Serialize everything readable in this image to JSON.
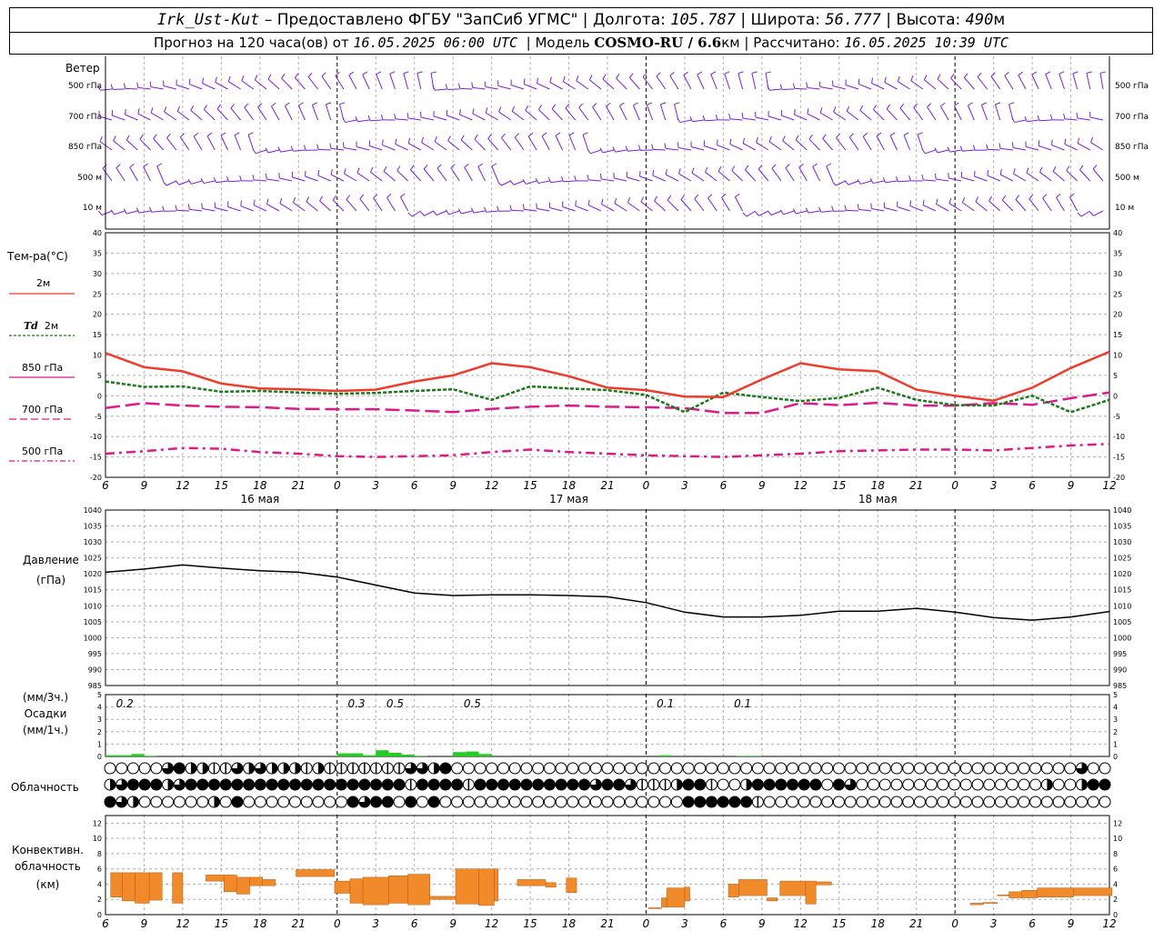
{
  "header": {
    "station": "Irk_Ust-Kut",
    "provided": "– Предоставлено ФГБУ \"ЗапСиб УГМС\"",
    "lon_label": "Долгота:",
    "lon": "105.787",
    "lat_label": "Широта:",
    "lat": "56.777",
    "alt_label": "Высота:",
    "alt": "490",
    "alt_unit": "м",
    "forecast_label": "Прогноз на 120 часа(ов) от",
    "forecast_start": "16.05.2025 06:00 UTC",
    "model_label": "Модель",
    "model": "COSMO-RU / 6.6",
    "model_unit": "км",
    "calc_label": "Рассчитано:",
    "calc_time": "16.05.2025 10:39 UTC"
  },
  "labels": {
    "wind": "Ветер",
    "wind_levels": [
      "500 гПа",
      "700 гПа",
      "850 гПа",
      "500 м",
      "10  м"
    ],
    "temp_title": "Тем-ра(°C)",
    "temp_2m": "2м",
    "td_prefix": "Td",
    "td_suffix": "2м",
    "t850": "850 гПа",
    "t700": "700 гПа",
    "t500": "500 гПа",
    "pressure_title": "Давление",
    "pressure_unit": "(гПа)",
    "precip_3h": "(мм/3ч.)",
    "precip_title": "Осадки",
    "precip_1h": "(мм/1ч.)",
    "cloud": "Облачность",
    "conv_1": "Конвективн.",
    "conv_2": "облачность",
    "conv_3": "(км)"
  },
  "colors": {
    "t2m": "#ef3b2c",
    "td2m": "#1a7a1a",
    "t_levels": "#e0198a",
    "wind": "#7b1fd6",
    "pressure": "#000000",
    "precip": "#22cc22",
    "convective": "#f08a2a"
  },
  "chart_data": [
    {
      "type": "line",
      "name": "temperature",
      "x_ticks": [
        "6",
        "9",
        "12",
        "15",
        "18",
        "21",
        "0",
        "3",
        "6",
        "9",
        "12",
        "15",
        "18",
        "21",
        "0",
        "3",
        "6",
        "9",
        "12",
        "15",
        "18",
        "21",
        "0",
        "3",
        "6",
        "9",
        "12"
      ],
      "day_labels": [
        {
          "text": "16 мая",
          "hour": 12
        },
        {
          "text": "17 мая",
          "hour": 36
        },
        {
          "text": "18 мая",
          "hour": 60
        }
      ],
      "ylim": [
        -20,
        40
      ],
      "y_ticks": [
        "40",
        "35",
        "30",
        "25",
        "20",
        "15",
        "10",
        "5",
        "0",
        "-5",
        "-10",
        "-15",
        "-20"
      ],
      "series": [
        {
          "name": "2м",
          "x": [
            0,
            3,
            6,
            9,
            12,
            15,
            18,
            21,
            24,
            27,
            30,
            33,
            36,
            39,
            42,
            45,
            48,
            51,
            54,
            57,
            60,
            63,
            66,
            69,
            72,
            75,
            78
          ],
          "values": [
            10.5,
            7,
            6,
            3,
            1.8,
            1.6,
            1.2,
            1.5,
            3.5,
            5,
            8,
            7,
            4.8,
            2,
            1.4,
            -0.2,
            -0.3,
            4,
            8,
            6.5,
            6,
            1.5,
            0,
            -1.2,
            2,
            6.8,
            10.8
          ]
        },
        {
          "name": "Td 2м",
          "x": [
            0,
            3,
            6,
            9,
            12,
            15,
            18,
            21,
            24,
            27,
            30,
            33,
            36,
            39,
            42,
            45,
            48,
            51,
            54,
            57,
            60,
            63,
            66,
            69,
            72,
            75,
            78
          ],
          "values": [
            3.5,
            2.2,
            2.3,
            1,
            1.2,
            0.8,
            0.5,
            0.7,
            1.2,
            1.6,
            -1,
            2.3,
            1.8,
            1.4,
            0.2,
            -4,
            0.8,
            -0.3,
            -1.3,
            -0.5,
            2,
            -1,
            -2.3,
            -2.4,
            0,
            -4,
            -1
          ]
        },
        {
          "name": "850 гПа",
          "x": [
            0,
            3,
            6,
            9,
            12,
            15,
            18,
            21,
            24,
            27,
            30,
            33,
            36,
            39,
            42,
            45,
            48,
            51,
            54,
            57,
            60,
            63,
            66,
            69,
            72,
            75,
            78
          ],
          "values": [
            -3,
            -1.8,
            -2.4,
            -2.7,
            -2.8,
            -3.2,
            -3.3,
            -3.3,
            -3.6,
            -4,
            -3.2,
            -2.7,
            -2.4,
            -2.7,
            -2.8,
            -3,
            -4.2,
            -4.2,
            -1.8,
            -2.3,
            -1.7,
            -2.4,
            -2.4,
            -1.8,
            -2.2,
            -0.6,
            0.8
          ]
        },
        {
          "name": "700 гПа",
          "x": [],
          "values": []
        },
        {
          "name": "500 гПа",
          "x": [
            0,
            3,
            6,
            9,
            12,
            15,
            18,
            21,
            24,
            27,
            30,
            33,
            36,
            39,
            42,
            45,
            48,
            51,
            54,
            57,
            60,
            63,
            66,
            69,
            72,
            75,
            78
          ],
          "values": [
            -14.2,
            -13.6,
            -12.8,
            -13,
            -13.8,
            -14.2,
            -14.8,
            -15,
            -14.8,
            -14.6,
            -13.8,
            -13.2,
            -13.8,
            -14.2,
            -14.6,
            -14.8,
            -15,
            -14.6,
            -14.2,
            -13.6,
            -13.4,
            -13.2,
            -13.2,
            -13.4,
            -12.8,
            -12.2,
            -11.8
          ]
        }
      ]
    },
    {
      "type": "line",
      "name": "pressure",
      "ylim": [
        985,
        1040
      ],
      "y_ticks": [
        "1040",
        "1035",
        "1030",
        "1025",
        "1020",
        "1015",
        "1010",
        "1005",
        "1000",
        "995",
        "990",
        "985"
      ],
      "x_ticks": [
        "6",
        "9",
        "12",
        "15",
        "18",
        "21",
        "0",
        "3",
        "6",
        "9",
        "12",
        "15",
        "18",
        "21",
        "0",
        "3",
        "6",
        "9",
        "12",
        "15",
        "18",
        "21",
        "0",
        "3",
        "6",
        "9",
        "12"
      ],
      "series": [
        {
          "name": "Давление",
          "x": [
            0,
            3,
            6,
            9,
            12,
            15,
            18,
            21,
            24,
            27,
            30,
            33,
            36,
            39,
            42,
            45,
            48,
            51,
            54,
            57,
            60,
            63,
            66,
            69,
            72,
            75,
            78
          ],
          "values": [
            1020.5,
            1021.5,
            1022.8,
            1021.8,
            1021,
            1020.5,
            1019,
            1016.5,
            1014,
            1013.2,
            1013.4,
            1013.4,
            1013.2,
            1012.8,
            1011,
            1008,
            1006.5,
            1006.5,
            1007,
            1008.3,
            1008.3,
            1009.2,
            1008,
            1006.3,
            1005.5,
            1006.5,
            1008.2
          ]
        }
      ]
    },
    {
      "type": "bar",
      "name": "precipitation",
      "ylim": [
        0,
        5
      ],
      "y_ticks": [
        "5",
        "4",
        "3",
        "2",
        "1",
        "0"
      ],
      "totals_3h": [
        {
          "hour": 1.5,
          "text": "0.2"
        },
        {
          "hour": 19.5,
          "text": "0.3"
        },
        {
          "hour": 22.5,
          "text": "0.5"
        },
        {
          "hour": 28.5,
          "text": "0.5"
        },
        {
          "hour": 43.5,
          "text": "0.1"
        },
        {
          "hour": 49.5,
          "text": "0.1"
        }
      ],
      "x": [
        0,
        1,
        2,
        3,
        18,
        19,
        20,
        21,
        22,
        23,
        24,
        27,
        28,
        29,
        43,
        49,
        50
      ],
      "values": [
        0.1,
        0.1,
        0.2,
        0.05,
        0.25,
        0.25,
        0.1,
        0.5,
        0.3,
        0.15,
        0.05,
        0.35,
        0.4,
        0.2,
        0.1,
        0.05,
        0.05
      ]
    },
    {
      "type": "table",
      "name": "cloud-cover",
      "legend": "0=clear 1=quarter 2=half 3=three-quarter 4=overcast",
      "rows": [
        [
          0,
          0,
          0,
          0,
          0,
          3,
          4,
          2,
          2,
          1,
          1,
          3,
          2,
          3,
          2,
          2,
          2,
          1,
          2,
          1,
          1,
          1,
          1,
          1,
          1,
          1,
          3,
          3,
          2,
          4,
          0,
          0,
          0,
          0,
          0,
          0,
          0,
          0,
          0,
          0,
          0,
          0,
          0,
          0,
          0,
          0,
          0,
          0,
          0,
          0,
          0,
          0,
          0,
          0,
          0,
          0,
          0,
          0,
          0,
          0,
          0,
          0,
          0,
          0,
          0,
          0,
          0,
          0,
          0,
          0,
          0,
          0,
          0,
          0,
          0,
          0,
          0,
          0,
          0,
          0,
          0,
          0,
          0,
          0,
          3,
          0,
          0
        ],
        [
          2,
          3,
          4,
          4,
          4,
          2,
          3,
          4,
          4,
          4,
          4,
          4,
          4,
          4,
          4,
          4,
          4,
          4,
          4,
          4,
          4,
          4,
          4,
          4,
          4,
          4,
          1,
          4,
          4,
          4,
          4,
          1,
          4,
          4,
          4,
          4,
          4,
          4,
          4,
          4,
          4,
          4,
          3,
          4,
          4,
          3,
          1,
          1,
          1,
          2,
          4,
          4,
          1,
          0,
          0,
          2,
          4,
          4,
          4,
          4,
          4,
          4,
          0,
          4,
          3,
          0,
          0,
          0,
          0,
          0,
          0,
          0,
          0,
          0,
          0,
          0,
          0,
          0,
          0,
          0,
          0,
          2,
          0,
          0,
          2,
          4,
          4
        ],
        [
          4,
          3,
          2,
          0,
          0,
          0,
          0,
          0,
          0,
          2,
          0,
          4,
          0,
          0,
          0,
          0,
          0,
          0,
          0,
          0,
          0,
          4,
          3,
          4,
          4,
          0,
          4,
          0,
          4,
          0,
          0,
          0,
          0,
          0,
          0,
          0,
          0,
          0,
          0,
          0,
          0,
          0,
          0,
          0,
          0,
          0,
          0,
          0,
          0,
          0,
          4,
          4,
          4,
          4,
          4,
          4,
          1,
          0,
          0,
          0,
          0,
          0,
          0,
          0,
          0,
          0,
          0,
          0,
          0,
          0,
          0,
          0,
          0,
          0,
          0,
          0,
          0,
          0,
          0,
          0,
          0,
          0,
          0,
          0,
          0,
          0,
          0
        ]
      ]
    },
    {
      "type": "bar",
      "name": "convective-cloud",
      "ylim": [
        0,
        13
      ],
      "y_ticks": [
        "12",
        "10",
        "8",
        "6",
        "4",
        "2",
        "0"
      ],
      "x_ticks": [
        "6",
        "9",
        "12",
        "15",
        "18",
        "21",
        "0",
        "3",
        "6",
        "9",
        "12",
        "15",
        "18",
        "21",
        "0",
        "3",
        "6",
        "9",
        "12",
        "15",
        "18",
        "21",
        "0",
        "3",
        "6",
        "9",
        "12"
      ],
      "segments": [
        [
          0.4,
          1.3,
          2.3,
          5.5
        ],
        [
          1.3,
          2.3,
          1.8,
          5.5
        ],
        [
          2.3,
          3.4,
          1.5,
          5.5
        ],
        [
          3.4,
          4.4,
          1.9,
          5.5
        ],
        [
          5.2,
          6.0,
          1.5,
          5.5
        ],
        [
          7.8,
          9.2,
          4.4,
          5.2
        ],
        [
          9.2,
          10.2,
          3.0,
          5.2
        ],
        [
          10.2,
          11.2,
          2.7,
          4.9
        ],
        [
          11.2,
          12.2,
          3.8,
          4.9
        ],
        [
          12.2,
          13.2,
          3.8,
          4.6
        ],
        [
          14.8,
          17.8,
          5.0,
          5.9
        ],
        [
          17.8,
          19.0,
          2.8,
          4.4
        ],
        [
          19.0,
          20.0,
          1.5,
          4.7
        ],
        [
          20.0,
          22.0,
          1.3,
          4.9
        ],
        [
          22.0,
          23.5,
          1.5,
          5.1
        ],
        [
          23.5,
          25.2,
          1.3,
          5.3
        ],
        [
          25.2,
          27.2,
          2.0,
          2.4
        ],
        [
          27.2,
          29.0,
          1.4,
          6.0
        ],
        [
          29.0,
          30.2,
          1.2,
          6.0
        ],
        [
          30.2,
          30.5,
          1.8,
          6.0
        ],
        [
          32.0,
          34.2,
          3.8,
          4.6
        ],
        [
          34.2,
          35.0,
          3.6,
          4.2
        ],
        [
          35.8,
          36.6,
          2.9,
          4.8
        ],
        [
          42.2,
          43.2,
          0.9,
          0.9
        ],
        [
          43.2,
          43.6,
          1.0,
          2.2
        ],
        [
          43.6,
          45.0,
          1.0,
          3.5
        ],
        [
          45.0,
          45.4,
          1.8,
          3.6
        ],
        [
          48.4,
          49.2,
          2.3,
          4.0
        ],
        [
          49.2,
          51.4,
          2.5,
          4.6
        ],
        [
          51.4,
          52.2,
          1.8,
          2.2
        ],
        [
          52.4,
          54.4,
          2.5,
          4.4
        ],
        [
          54.4,
          55.2,
          1.4,
          4.4
        ],
        [
          55.2,
          56.4,
          3.9,
          4.3
        ],
        [
          67.2,
          68.2,
          1.3,
          1.5
        ],
        [
          68.2,
          69.3,
          1.5,
          1.6
        ],
        [
          69.3,
          70.2,
          2.5,
          2.6
        ],
        [
          70.2,
          71.2,
          2.2,
          3.0
        ],
        [
          71.2,
          72.4,
          2.2,
          3.2
        ],
        [
          72.4,
          75.2,
          2.3,
          3.5
        ],
        [
          75.2,
          78.2,
          2.5,
          3.5
        ]
      ]
    }
  ]
}
